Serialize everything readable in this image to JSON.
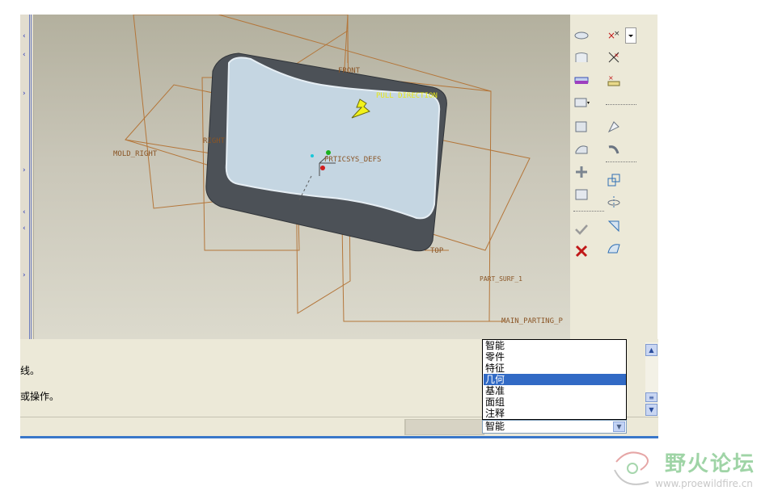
{
  "viewport": {
    "labels": {
      "front": "FRONT",
      "pull_direction": "PULL DIRECTION",
      "mold_right": "MOLD_RIGHT",
      "right": "RIGHT",
      "csys": "PRTICSYS_DEFS",
      "top": "TOP",
      "part_surf": "PART_SURF_1",
      "main_parting": "MAIN_PARTING_P"
    },
    "colors": {
      "datum": "#b4763a",
      "pull": "#f2f21a",
      "surface": "#c5d6e2",
      "shell": "#4c5157"
    }
  },
  "toolbar": {
    "icons": [
      "extrude-icon",
      "cross-points-icon",
      "revolve-icon",
      "datum-points-icon",
      "sweep-icon",
      "offset-points-icon",
      "copy-surface-icon",
      "hole-icon",
      "offset-icon",
      "blend-icon",
      "merge-icon",
      "fill-icon",
      "pattern-icon",
      "extend-icon",
      "mirror-icon",
      "transform-icon",
      "ok-check-icon",
      "wrap-icon",
      "cancel-x-icon",
      "freeform-icon"
    ]
  },
  "message_area": {
    "lines": [
      "线。",
      "或操作。"
    ]
  },
  "filter": {
    "options": [
      "智能",
      "零件",
      "特征",
      "几何",
      "基准",
      "面组",
      "注释"
    ],
    "highlighted": "几何",
    "selected": "智能"
  },
  "watermark": {
    "title": "野火论坛",
    "url": "www.proewildfire.cn"
  }
}
